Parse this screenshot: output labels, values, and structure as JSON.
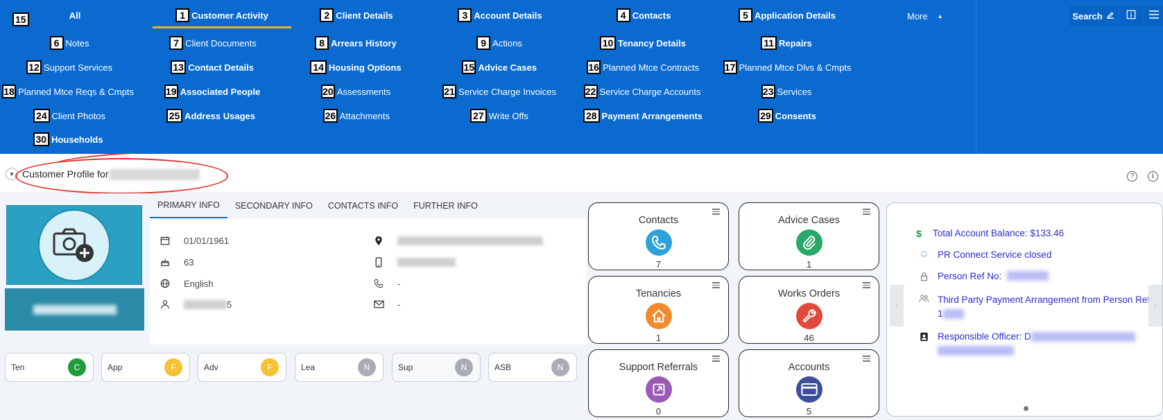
{
  "nav": {
    "items": [
      {
        "label": "All",
        "badge": "",
        "bold": true
      },
      {
        "label": "Customer Activity",
        "badge": "1",
        "bold": true
      },
      {
        "label": "Client Details",
        "badge": "2",
        "bold": true
      },
      {
        "label": "Account Details",
        "badge": "3",
        "bold": true
      },
      {
        "label": "Contacts",
        "badge": "4",
        "bold": true
      },
      {
        "label": "Application Details",
        "badge": "5",
        "bold": true
      },
      {
        "label": "Notes",
        "badge": "6",
        "bold": false
      },
      {
        "label": "Client Documents",
        "badge": "7",
        "bold": false
      },
      {
        "label": "Arrears History",
        "badge": "8",
        "bold": true
      },
      {
        "label": "Actions",
        "badge": "9",
        "bold": false
      },
      {
        "label": "Tenancy Details",
        "badge": "10",
        "bold": true
      },
      {
        "label": "Repairs",
        "badge": "11",
        "bold": true
      },
      {
        "label": "Support Services",
        "badge": "12",
        "bold": false
      },
      {
        "label": "Contact Details",
        "badge": "13",
        "bold": true
      },
      {
        "label": "Housing Options",
        "badge": "14",
        "bold": true
      },
      {
        "label": "Advice Cases",
        "badge": "15",
        "bold": true
      },
      {
        "label": "Planned Mtce Contracts",
        "badge": "16",
        "bold": false
      },
      {
        "label": "Planned Mtce Dlvs & Cmpts",
        "badge": "17",
        "bold": false
      },
      {
        "label": "Planned Mtce Reqs & Cmpts",
        "badge": "18",
        "bold": false
      },
      {
        "label": "Associated People",
        "badge": "19",
        "bold": true
      },
      {
        "label": "Assessments",
        "badge": "20",
        "bold": false
      },
      {
        "label": "Service Charge Invoices",
        "badge": "21",
        "bold": false
      },
      {
        "label": "Service Charge Accounts",
        "badge": "22",
        "bold": false
      },
      {
        "label": "Services",
        "badge": "23",
        "bold": false
      },
      {
        "label": "Client Photos",
        "badge": "24",
        "bold": false
      },
      {
        "label": "Address Usages",
        "badge": "25",
        "bold": true
      },
      {
        "label": "Attachments",
        "badge": "26",
        "bold": false
      },
      {
        "label": "Write Offs",
        "badge": "27",
        "bold": false
      },
      {
        "label": "Payment Arrangements",
        "badge": "28",
        "bold": true
      },
      {
        "label": "Consents",
        "badge": "29",
        "bold": true
      },
      {
        "label": "Households",
        "badge": "30",
        "bold": true
      }
    ],
    "all_badge": "15",
    "more_label": "More",
    "search_label": "Search"
  },
  "profile": {
    "title_prefix": "Customer Profile for"
  },
  "tabs": [
    "PRIMARY INFO",
    "SECONDARY INFO",
    "CONTACTS INFO",
    "FURTHER INFO"
  ],
  "primary_info": {
    "dob": "01/01/1961",
    "age": "63",
    "language": "English",
    "id_suffix": "5",
    "landline": "-",
    "email": "-"
  },
  "status_pills": [
    {
      "label": "Ten",
      "code": "C",
      "color": "#1e9b3a"
    },
    {
      "label": "App",
      "code": "F",
      "color": "#f5c232"
    },
    {
      "label": "Adv",
      "code": "F",
      "color": "#f5c232"
    },
    {
      "label": "Lea",
      "code": "N",
      "color": "#a9adb3"
    },
    {
      "label": "Sup",
      "code": "N",
      "color": "#a9adb3"
    },
    {
      "label": "ASB",
      "code": "N",
      "color": "#a9adb3"
    }
  ],
  "cards": [
    {
      "title": "Contacts",
      "count": "7",
      "icon": "phone-icon",
      "color": "#2ea1d8"
    },
    {
      "title": "Advice Cases",
      "count": "1",
      "icon": "paperclip-icon",
      "color": "#2aa869"
    },
    {
      "title": "Tenancies",
      "count": "1",
      "icon": "house-icon",
      "color": "#f08a2c"
    },
    {
      "title": "Works Orders",
      "count": "46",
      "icon": "wrench-icon",
      "color": "#e0493b"
    },
    {
      "title": "Support Referrals",
      "count": "0",
      "icon": "external-link-icon",
      "color": "#9b5ab3"
    },
    {
      "title": "Accounts",
      "count": "5",
      "icon": "credit-card-icon",
      "color": "#3d4f9a"
    }
  ],
  "summary": {
    "balance": "Total Account Balance: $133.46",
    "pr_connect": "PR Connect Service closed",
    "person_ref": "Person Ref No:",
    "third_party": "Third Party Payment Arrangement from Person Ref:",
    "third_party_ref_start": "1",
    "officer": "Responsible Officer: D"
  },
  "colors": {
    "nav_bg": "#0a6ad0",
    "active_underline": "#f2b21a",
    "summary_text": "#2a2ccf"
  }
}
